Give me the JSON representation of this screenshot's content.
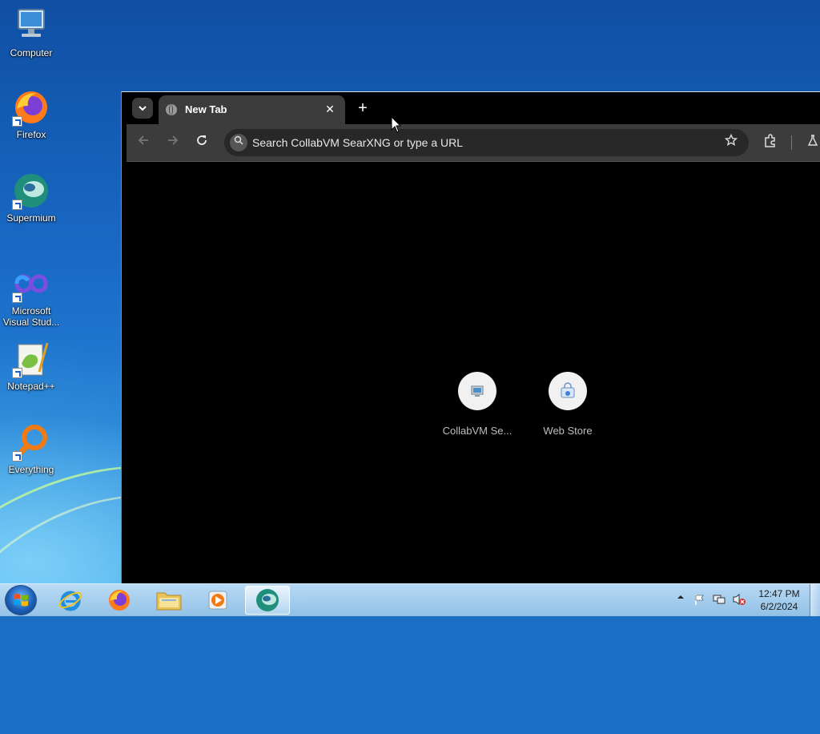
{
  "desktop": {
    "icons": [
      {
        "label": "Computer",
        "icon": "computer-icon"
      },
      {
        "label": "Firefox",
        "icon": "firefox-icon"
      },
      {
        "label": "Supermium",
        "icon": "supermium-icon"
      },
      {
        "label": "Microsoft Visual Stud...",
        "icon": "visual-studio-icon"
      },
      {
        "label": "Notepad++",
        "icon": "notepad-plus-plus-icon"
      },
      {
        "label": "Everything",
        "icon": "everything-search-icon"
      }
    ]
  },
  "browser": {
    "tab": {
      "title": "New Tab",
      "close": "✕"
    },
    "new_tab_symbol": "+",
    "omnibox": {
      "placeholder": "Search CollabVM SearXNG or type a URL"
    },
    "shortcuts": [
      {
        "label": "CollabVM Se...",
        "icon": "collabvm-icon"
      },
      {
        "label": "Web Store",
        "icon": "web-store-icon"
      }
    ]
  },
  "taskbar": {
    "apps": [
      "internet-explorer-icon",
      "firefox-icon",
      "file-explorer-icon",
      "media-player-icon",
      "supermium-icon"
    ],
    "active_app": "supermium-icon",
    "clock": {
      "time": "12:47 PM",
      "date": "6/2/2024"
    }
  },
  "colors": {
    "browser_frame": "#000000",
    "toolbar": "#3c3c3c",
    "omnibox": "#282828",
    "taskbar": "#a9cde9"
  }
}
